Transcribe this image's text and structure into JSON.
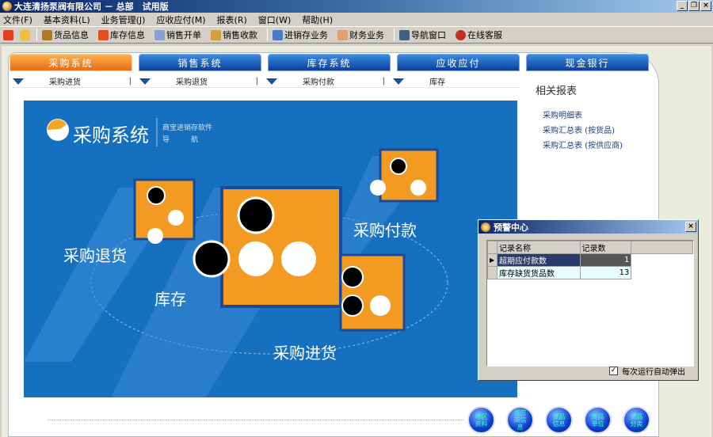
{
  "window": {
    "title": "大连清扬泵阀有限公司 － 总部　试用版"
  },
  "menu": [
    "文件(F)",
    "基本资料(L)",
    "业务管理(J)",
    "应收应付(M)",
    "报表(R)",
    "窗口(W)",
    "帮助(H)"
  ],
  "toolbar": [
    {
      "label": "货品信息",
      "icon": "goods-icon",
      "color": "#b07a20"
    },
    {
      "label": "库存信息",
      "icon": "house-icon",
      "color": "#e05020"
    },
    {
      "label": "销售开单",
      "icon": "sales-order-icon",
      "color": "#8aa0d0"
    },
    {
      "label": "销售收款",
      "icon": "sales-receipt-icon",
      "color": "#d0a040"
    },
    {
      "label": "进销存业务",
      "icon": "inventory-business-icon",
      "color": "#4a7ac0"
    },
    {
      "label": "财务业务",
      "icon": "finance-icon",
      "color": "#e0a070"
    },
    {
      "label": "导航窗口",
      "icon": "navigation-icon",
      "color": "#406080"
    },
    {
      "label": "在线客服",
      "icon": "qq-icon",
      "color": "#c03020"
    }
  ],
  "tabs": [
    "采购系统",
    "销售系统",
    "库存系统",
    "应收应付",
    "现金银行"
  ],
  "subnav": [
    "采购进货",
    "采购退货",
    "采购付款",
    "库存"
  ],
  "banner": {
    "title": "采购系统",
    "subtitle1": "商宝进销存软件",
    "subtitle2": "导　　　航",
    "labels": {
      "return": "采购退货",
      "stock": "库存",
      "pay": "采购付款",
      "purchase": "采购进货"
    }
  },
  "reports": {
    "title": "相关报表",
    "items": [
      "采购明细表",
      "采购汇总表 (按货品)",
      "采购汇总表 (按供应商)"
    ]
  },
  "dialog": {
    "title": "预警中心",
    "columns": [
      "记录名称",
      "记录数"
    ],
    "rows": [
      {
        "name": "超期应付款数",
        "count": "1"
      },
      {
        "name": "库存缺货货品数",
        "count": "13"
      }
    ],
    "checkbox": "每次运行自动弹出",
    "checked": true
  },
  "shortcuts": [
    "地区资料",
    "供应商信息",
    "货品信息",
    "货品单位",
    "货品分类"
  ]
}
